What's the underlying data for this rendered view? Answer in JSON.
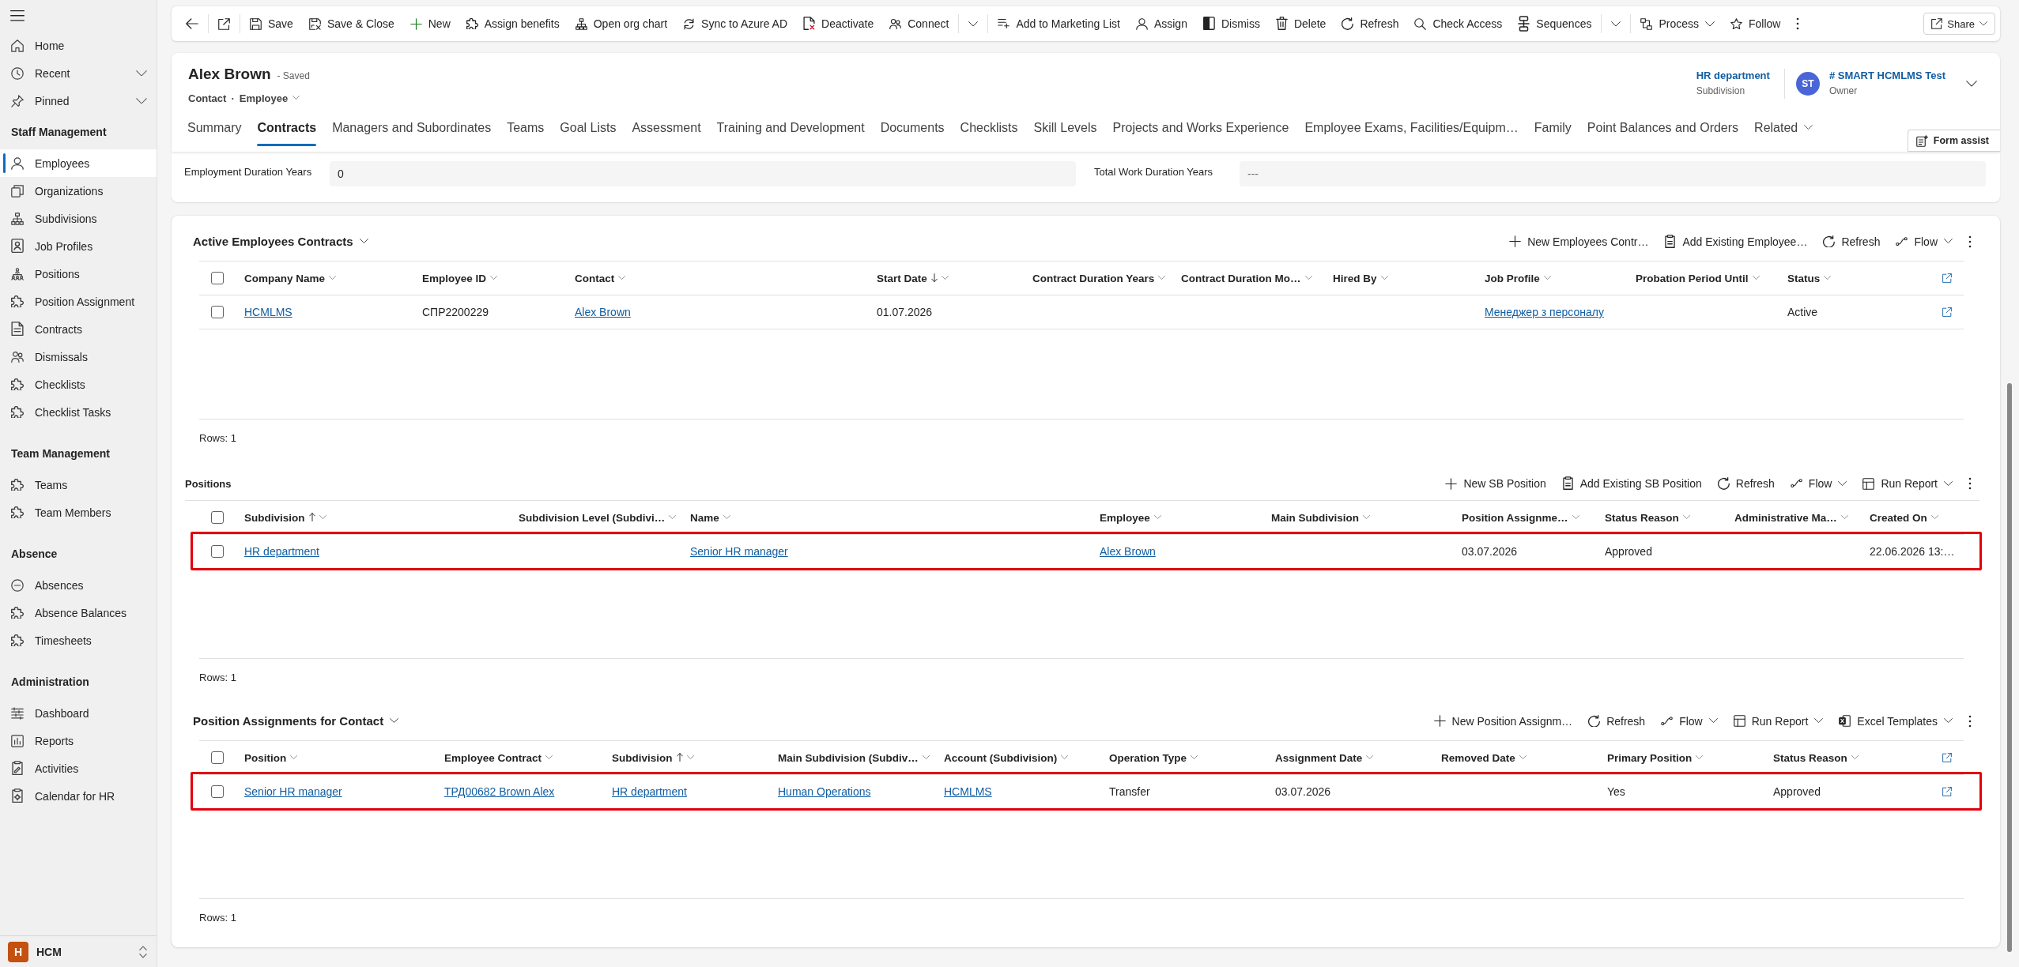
{
  "sidebar": {
    "top_items": [
      {
        "label": "Home",
        "selected": false
      },
      {
        "label": "Recent",
        "selected": false,
        "expanded": false
      },
      {
        "label": "Pinned",
        "selected": false,
        "expanded": false
      }
    ],
    "groups": [
      {
        "title": "Staff Management",
        "items": [
          {
            "label": "Employees",
            "selected": true
          },
          {
            "label": "Organizations",
            "selected": false
          },
          {
            "label": "Subdivisions",
            "selected": false
          },
          {
            "label": "Job Profiles",
            "selected": false
          },
          {
            "label": "Positions",
            "selected": false
          },
          {
            "label": "Position Assignment",
            "selected": false
          },
          {
            "label": "Contracts",
            "selected": false
          },
          {
            "label": "Dismissals",
            "selected": false
          },
          {
            "label": "Checklists",
            "selected": false
          },
          {
            "label": "Checklist Tasks",
            "selected": false
          }
        ]
      },
      {
        "title": "Team Management",
        "items": [
          {
            "label": "Teams",
            "selected": false
          },
          {
            "label": "Team Members",
            "selected": false
          }
        ]
      },
      {
        "title": "Absence",
        "items": [
          {
            "label": "Absences",
            "selected": false
          },
          {
            "label": "Absence Balances",
            "selected": false
          },
          {
            "label": "Timesheets",
            "selected": false
          }
        ]
      },
      {
        "title": "Administration",
        "items": [
          {
            "label": "Dashboard",
            "selected": false
          },
          {
            "label": "Reports",
            "selected": false
          },
          {
            "label": "Activities",
            "selected": false
          },
          {
            "label": "Calendar for HR",
            "selected": false
          }
        ]
      }
    ],
    "area": {
      "initial": "H",
      "label": "HCM"
    }
  },
  "command_bar": {
    "groups": [
      {
        "items": [
          {
            "kind": "save",
            "label": "Save",
            "menu": false
          },
          {
            "kind": "save-close",
            "label": "Save & Close",
            "menu": false
          },
          {
            "kind": "new",
            "label": "New",
            "menu": false
          },
          {
            "kind": "assign-benefits",
            "label": "Assign benefits",
            "menu": false
          },
          {
            "kind": "open-org-chart",
            "label": "Open org chart",
            "menu": false
          },
          {
            "kind": "sync",
            "label": "Sync to Azure AD",
            "menu": false
          },
          {
            "kind": "deactivate",
            "label": "Deactivate",
            "menu": false
          },
          {
            "kind": "connect",
            "label": "Connect",
            "menu": false
          }
        ]
      },
      {
        "items": [
          {
            "kind": "add-to-marketing-list",
            "label": "Add to Marketing List",
            "menu": false
          },
          {
            "kind": "assign",
            "label": "Assign",
            "menu": false
          },
          {
            "kind": "dismiss",
            "label": "Dismiss",
            "menu": false
          },
          {
            "kind": "delete",
            "label": "Delete",
            "menu": false
          },
          {
            "kind": "refresh",
            "label": "Refresh",
            "menu": false
          },
          {
            "kind": "check-access",
            "label": "Check Access",
            "menu": false
          },
          {
            "kind": "sequences",
            "label": "Sequences",
            "menu": false
          }
        ]
      },
      {
        "items": [
          {
            "kind": "process",
            "label": "Process",
            "menu": true
          },
          {
            "kind": "follow",
            "label": "Follow",
            "menu": false
          }
        ]
      }
    ],
    "share": {
      "label": "Share"
    }
  },
  "record": {
    "title": "Alex Brown",
    "save_status": "- Saved",
    "entity": "Contact",
    "separator": "·",
    "form": "Employee",
    "header_fields": [
      {
        "value": "HR department",
        "label": "Subdivision"
      },
      {
        "value": "# SMART HCMLMS Test",
        "label": "Owner",
        "initials": "ST"
      }
    ]
  },
  "tabs": [
    {
      "label": "Summary",
      "kind": "tab",
      "selected": false
    },
    {
      "label": "Contracts",
      "kind": "tab",
      "selected": true
    },
    {
      "label": "Managers and Subordinates",
      "kind": "tab",
      "selected": false
    },
    {
      "label": "Teams",
      "kind": "tab",
      "selected": false
    },
    {
      "label": "Goal Lists",
      "kind": "tab",
      "selected": false
    },
    {
      "label": "Assessment",
      "kind": "tab",
      "selected": false
    },
    {
      "label": "Training and Development",
      "kind": "tab",
      "selected": false
    },
    {
      "label": "Documents",
      "kind": "tab",
      "selected": false
    },
    {
      "label": "Checklists",
      "kind": "tab",
      "selected": false
    },
    {
      "label": "Skill Levels",
      "kind": "tab",
      "selected": false
    },
    {
      "label": "Projects and Works Experience",
      "kind": "tab",
      "selected": false
    },
    {
      "label": "Employee Exams, Facilities/Equipm…",
      "kind": "tab",
      "selected": false
    },
    {
      "label": "Family",
      "kind": "tab",
      "selected": false
    },
    {
      "label": "Point Balances and Orders",
      "kind": "tab",
      "selected": false
    },
    {
      "label": "Related",
      "kind": "menu",
      "selected": false
    }
  ],
  "form_assist": {
    "label": "Form assist"
  },
  "form_fields": [
    {
      "label": "Employment Duration Years",
      "value": "0"
    },
    {
      "label": "Total Work Duration Years",
      "placeholder": "---"
    }
  ],
  "subgrids": [
    {
      "kind": "view",
      "title": "Active Employees Contracts",
      "commands": [
        {
          "kind": "new",
          "label": "New Employees Contr…",
          "menu": false
        },
        {
          "kind": "add-existing",
          "label": "Add Existing Employee…",
          "menu": false
        },
        {
          "kind": "refresh",
          "label": "Refresh",
          "menu": false
        },
        {
          "kind": "flow",
          "label": "Flow",
          "menu": true
        },
        {
          "kind": "more"
        }
      ],
      "all_selected": false,
      "columns": [
        {
          "label": "Company Name",
          "sorted_ascending": false,
          "sorted_descending": false
        },
        {
          "label": "Employee ID",
          "sorted_ascending": false,
          "sorted_descending": false
        },
        {
          "label": "Contact",
          "sorted_ascending": false,
          "sorted_descending": false
        },
        {
          "label": "Start Date",
          "sorted_ascending": false,
          "sorted_descending": true
        },
        {
          "label": "Contract Duration Years",
          "sorted_ascending": false,
          "sorted_descending": false
        },
        {
          "label": "Contract Duration Mo…",
          "sorted_ascending": false,
          "sorted_descending": false
        },
        {
          "label": "Hired By",
          "sorted_ascending": false,
          "sorted_descending": false
        },
        {
          "label": "Job Profile",
          "sorted_ascending": false,
          "sorted_descending": false
        },
        {
          "label": "Probation Period Until",
          "sorted_ascending": false,
          "sorted_descending": false
        },
        {
          "label": "Status",
          "sorted_ascending": false,
          "sorted_descending": false
        }
      ],
      "open_column": true,
      "rows": [
        {
          "selected": false,
          "highlighted": false,
          "cells": [
            {
              "text": "HCMLMS",
              "link": true
            },
            {
              "text": "СПР2200229",
              "link": false
            },
            {
              "text": "Alex Brown",
              "link": true
            },
            {
              "text": "01.07.2026",
              "link": false
            },
            null,
            null,
            null,
            {
              "text": "Менеджер з персоналу",
              "link": true
            },
            null,
            {
              "text": "Active",
              "link": false
            }
          ]
        }
      ],
      "footer": "Rows: 1"
    },
    {
      "kind": "section",
      "title": "Positions",
      "commands": [
        {
          "kind": "new",
          "label": "New SB Position",
          "menu": false
        },
        {
          "kind": "add-existing",
          "label": "Add Existing SB Position",
          "menu": false
        },
        {
          "kind": "refresh",
          "label": "Refresh",
          "menu": false
        },
        {
          "kind": "flow",
          "label": "Flow",
          "menu": true
        },
        {
          "kind": "run-report",
          "label": "Run Report",
          "menu": true
        },
        {
          "kind": "more"
        }
      ],
      "all_selected": false,
      "columns": [
        {
          "label": "Subdivision",
          "sorted_ascending": true,
          "sorted_descending": false
        },
        {
          "label": "Subdivision Level (Subdivi…",
          "sorted_ascending": false,
          "sorted_descending": false
        },
        {
          "label": "Name",
          "sorted_ascending": false,
          "sorted_descending": false
        },
        {
          "label": "Employee",
          "sorted_ascending": false,
          "sorted_descending": false
        },
        {
          "label": "Main Subdivision",
          "sorted_ascending": false,
          "sorted_descending": false
        },
        {
          "label": "Position Assignme…",
          "sorted_ascending": false,
          "sorted_descending": false
        },
        {
          "label": "Status Reason",
          "sorted_ascending": false,
          "sorted_descending": false
        },
        {
          "label": "Administrative Ma…",
          "sorted_ascending": false,
          "sorted_descending": false
        },
        {
          "label": "Created On",
          "sorted_ascending": false,
          "sorted_descending": false
        }
      ],
      "rows": [
        {
          "selected": false,
          "highlighted": true,
          "cells": [
            {
              "text": "HR department",
              "link": true
            },
            null,
            {
              "text": "Senior HR manager",
              "link": true
            },
            {
              "text": "Alex Brown",
              "link": true
            },
            null,
            {
              "text": "03.07.2026",
              "link": false
            },
            {
              "text": "Approved",
              "link": false
            },
            null,
            {
              "text": "22.06.2026 13:…",
              "link": false
            }
          ]
        }
      ],
      "footer": "Rows: 1"
    },
    {
      "kind": "view",
      "title": "Position Assignments for Contact",
      "commands": [
        {
          "kind": "new",
          "label": "New Position Assignm…",
          "menu": false
        },
        {
          "kind": "refresh",
          "label": "Refresh",
          "menu": false
        },
        {
          "kind": "flow",
          "label": "Flow",
          "menu": true
        },
        {
          "kind": "run-report",
          "label": "Run Report",
          "menu": true
        },
        {
          "kind": "excel-templates",
          "label": "Excel Templates",
          "menu": true
        },
        {
          "kind": "more"
        }
      ],
      "all_selected": false,
      "columns": [
        {
          "label": "Position",
          "sorted_ascending": false,
          "sorted_descending": false
        },
        {
          "label": "Employee Contract",
          "sorted_ascending": false,
          "sorted_descending": false
        },
        {
          "label": "Subdivision",
          "sorted_ascending": true,
          "sorted_descending": false
        },
        {
          "label": "Main Subdivision (Subdiv…",
          "sorted_ascending": false,
          "sorted_descending": false
        },
        {
          "label": "Account (Subdivision)",
          "sorted_ascending": false,
          "sorted_descending": false
        },
        {
          "label": "Operation Type",
          "sorted_ascending": false,
          "sorted_descending": false
        },
        {
          "label": "Assignment Date",
          "sorted_ascending": false,
          "sorted_descending": false
        },
        {
          "label": "Removed Date",
          "sorted_ascending": false,
          "sorted_descending": false
        },
        {
          "label": "Primary Position",
          "sorted_ascending": false,
          "sorted_descending": false
        },
        {
          "label": "Status Reason",
          "sorted_ascending": false,
          "sorted_descending": false
        }
      ],
      "open_column": true,
      "rows": [
        {
          "selected": false,
          "highlighted": true,
          "cells": [
            {
              "text": "Senior HR manager",
              "link": true
            },
            {
              "text": "ТРД00682 Brown Alex",
              "link": true
            },
            {
              "text": "HR department",
              "link": true
            },
            {
              "text": "Human Operations",
              "link": true
            },
            {
              "text": "HCMLMS",
              "link": true
            },
            {
              "text": "Transfer",
              "link": false
            },
            {
              "text": "03.07.2026",
              "link": false
            },
            null,
            {
              "text": "Yes",
              "link": false
            },
            {
              "text": "Approved",
              "link": false
            }
          ]
        }
      ],
      "footer": "Rows: 1"
    }
  ]
}
